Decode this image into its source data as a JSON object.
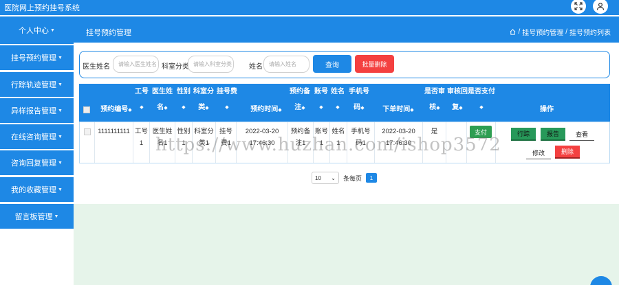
{
  "app": {
    "title": "医院网上预约挂号系统"
  },
  "topbar": {
    "fullscreen_icon": "expand-icon",
    "user_icon": "user-icon"
  },
  "sidebar": {
    "items": [
      {
        "label": "个人中心"
      },
      {
        "label": "挂号预约管理"
      },
      {
        "label": "行踪轨迹管理"
      },
      {
        "label": "异样报告管理"
      },
      {
        "label": "在线咨询管理"
      },
      {
        "label": "咨询回复管理"
      },
      {
        "label": "我的收藏管理"
      },
      {
        "label": "留言板管理"
      }
    ]
  },
  "header": {
    "title": "挂号预约管理",
    "breadcrumb": {
      "sep": "/",
      "level1": "挂号预约管理",
      "level2": "挂号预约列表"
    }
  },
  "search": {
    "doctor_label": "医生姓名",
    "doctor_placeholder": "请输入医生姓名",
    "dept_label": "科室分类",
    "dept_placeholder": "请输入科室分类",
    "name_label": "姓名",
    "name_placeholder": "请输入姓名",
    "query_button": "查询",
    "bulk_delete_button": "批量删除"
  },
  "table": {
    "headers": {
      "booking_no": "预约编号",
      "job_no_1": "工号",
      "job_no_2": "1",
      "doctor_1": "医生姓",
      "doctor_2": "名",
      "gender": "性别",
      "dept_1": "科室分",
      "dept_2": "类",
      "fee": "挂号费",
      "time": "预约时间",
      "note_1": "预约备",
      "note_2": "注",
      "account": "账号",
      "name": "姓名",
      "phone_1": "手机号",
      "phone_2": "码",
      "order_time": "下单时间",
      "audit_1": "是否审",
      "audit_2": "核",
      "reply_1": "审核回",
      "reply_2": "复",
      "paid": "是否支付",
      "actions": "操作",
      "sort_glyph": "◆"
    },
    "rows": [
      {
        "booking_no": "1111111111",
        "job_no": "工号",
        "job_no_2": "1",
        "doctor": "医生姓",
        "doctor_2": "名1",
        "gender": "性别",
        "gender_2": "1",
        "dept": "科室分",
        "dept_2": "类1",
        "fee": "挂号",
        "fee_2": "费1",
        "time_date": "2022-03-20",
        "time_clock": "17:46:30",
        "note": "预约备",
        "note_2": "注1",
        "account": "账号",
        "account_2": "1",
        "name": "姓名",
        "name_2": "1",
        "phone": "手机号",
        "phone_2": "码1",
        "order_date": "2022-03-20",
        "order_clock": "17:46:30",
        "audit": "是",
        "reply": "",
        "pay_button": "支付",
        "track_button": "行踪",
        "report_button": "报告",
        "view_button": "查看",
        "edit_button": "修改",
        "delete_button": "删除"
      }
    ]
  },
  "pagination": {
    "page_size": "10",
    "per_page_label": "条每页",
    "current_page": "1"
  },
  "watermark": "https://www.huzhan.com/ishop3572",
  "colors": {
    "primary": "#1e88e5",
    "danger": "#f44040",
    "success": "#27995a",
    "lower_bg": "#e6f4ea"
  }
}
